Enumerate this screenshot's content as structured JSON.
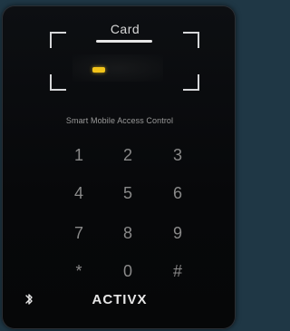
{
  "device": {
    "card_label": "Card",
    "title": "Smart Mobile Access Control",
    "logo": "ACTIVX",
    "bluetooth_icon": "bluetooth-icon",
    "colors": {
      "background": "#1f3745",
      "panel": "#0b0c0f",
      "led": "#f2c41a",
      "key_text": "#8a8a8a"
    }
  },
  "keypad": {
    "keys": [
      "1",
      "2",
      "3",
      "4",
      "5",
      "6",
      "7",
      "8",
      "9",
      "*",
      "0",
      "#"
    ]
  }
}
